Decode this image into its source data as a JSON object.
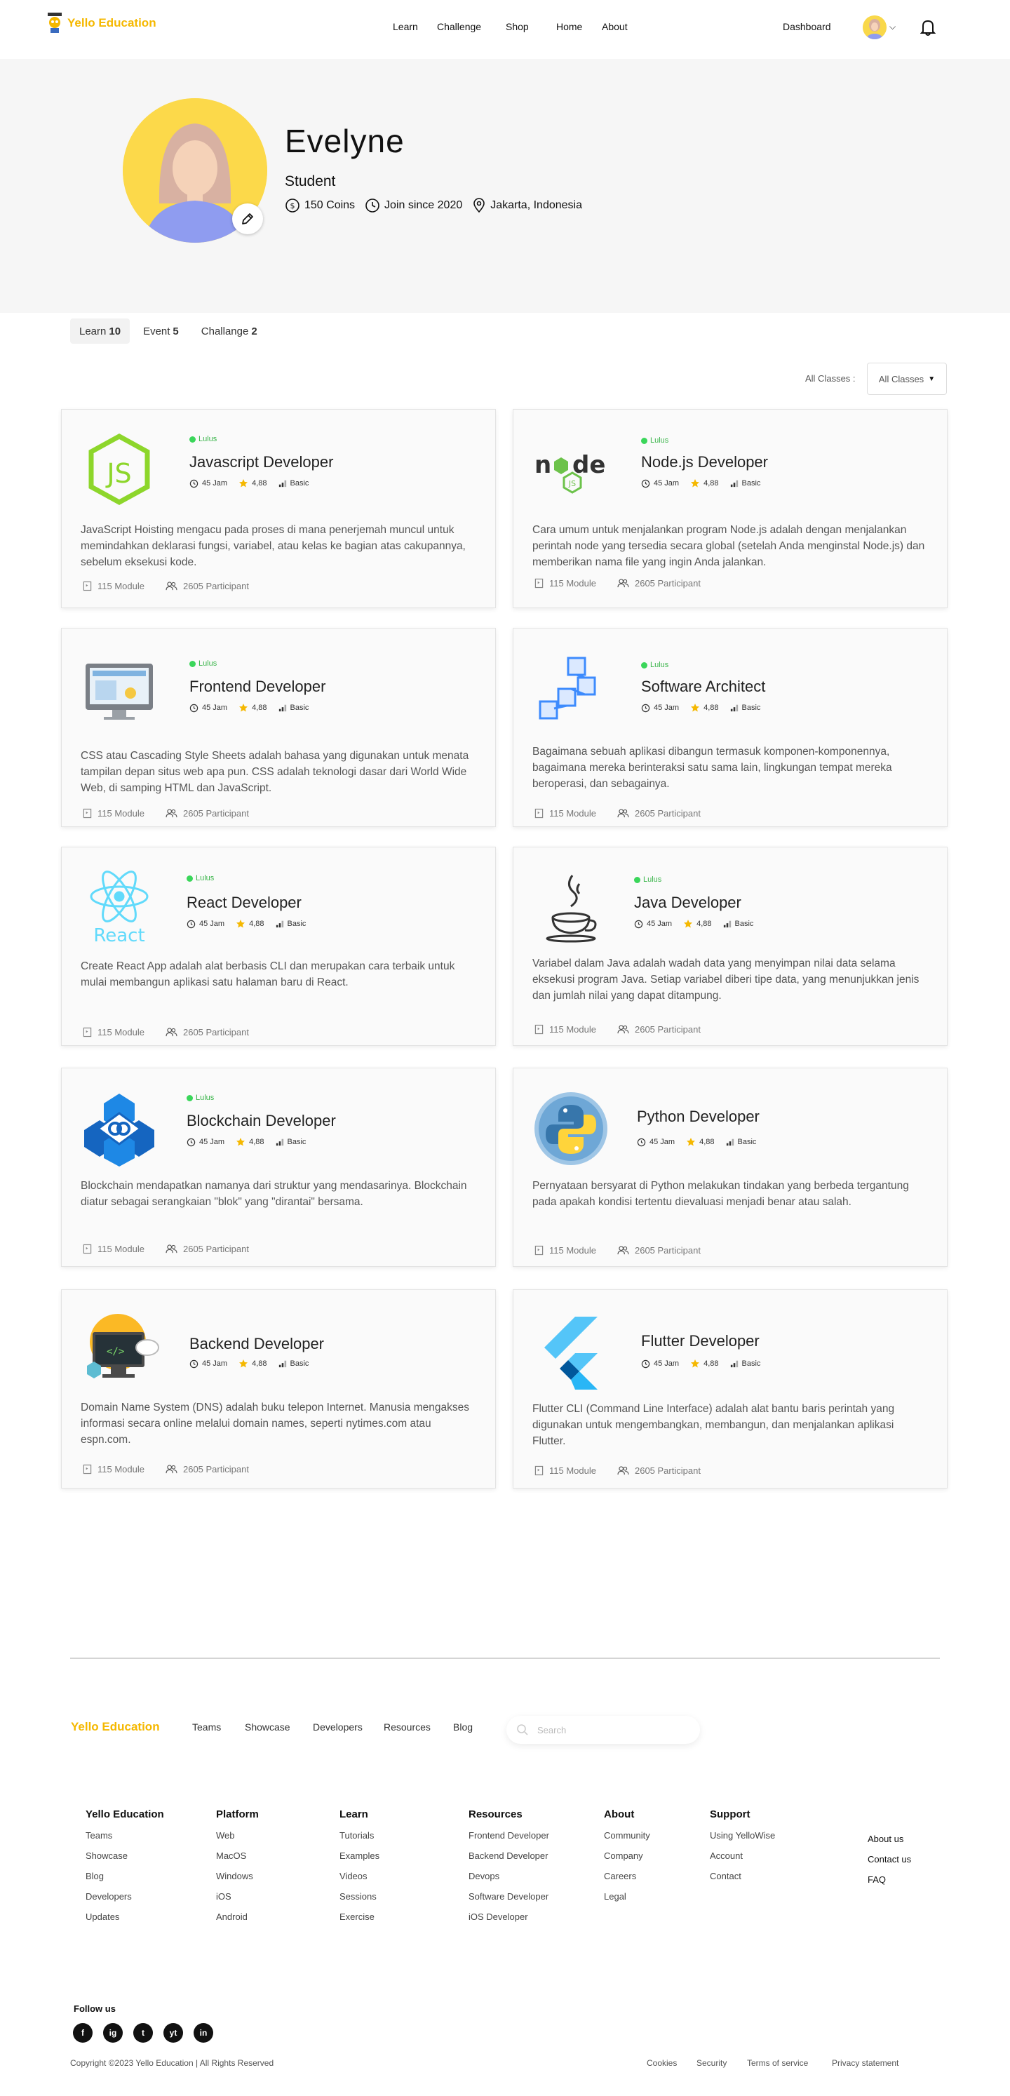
{
  "nav": {
    "brand": "Yello Education",
    "links": [
      "Learn",
      "Challenge",
      "Shop",
      "Home",
      "About"
    ],
    "dashboard": "Dashboard"
  },
  "profile": {
    "name": "Evelyne",
    "role": "Student",
    "coins": "150 Coins",
    "joined": "Join since 2020",
    "location": "Jakarta, Indonesia"
  },
  "tabs": [
    {
      "label": "Learn",
      "count": "10"
    },
    {
      "label": "Event",
      "count": "5"
    },
    {
      "label": "Challange",
      "count": "2"
    }
  ],
  "filter": {
    "label": "All Classes :",
    "value": "All Classes"
  },
  "courses": [
    {
      "badge": "Lulus",
      "title": "Javascript Developer",
      "hours": "45 Jam",
      "rating": "4,88",
      "level": "Basic",
      "desc": "JavaScript Hoisting mengacu pada proses di mana penerjemah muncul untuk memindahkan deklarasi fungsi, variabel, atau kelas ke bagian atas cakupannya, sebelum eksekusi kode.",
      "modules": "115 Module",
      "participants": "2605 Participant",
      "icon": "javascript-icon"
    },
    {
      "badge": "Lulus",
      "title": "Node.js Developer",
      "hours": "45 Jam",
      "rating": "4,88",
      "level": "Basic",
      "desc": "Cara umum untuk menjalankan program Node.js adalah dengan menjalankan perintah node yang tersedia secara global (setelah Anda menginstal Node.js) dan memberikan nama file yang ingin Anda jalankan.",
      "modules": "115 Module",
      "participants": "2605 Participant",
      "icon": "nodejs-icon"
    },
    {
      "badge": "Lulus",
      "title": "Frontend Developer",
      "hours": "45 Jam",
      "rating": "4,88",
      "level": "Basic",
      "desc": "CSS atau Cascading Style Sheets adalah bahasa yang digunakan untuk menata tampilan depan situs web apa pun. CSS adalah teknologi dasar dari World Wide Web, di samping HTML dan JavaScript.",
      "modules": "115 Module",
      "participants": "2605 Participant",
      "icon": "frontend-icon"
    },
    {
      "badge": "Lulus",
      "title": "Software Architect",
      "hours": "45 Jam",
      "rating": "4,88",
      "level": "Basic",
      "desc": "Bagaimana sebuah aplikasi dibangun termasuk komponen-komponennya, bagaimana mereka berinteraksi satu sama lain, lingkungan tempat mereka beroperasi, dan sebagainya.",
      "modules": "115 Module",
      "participants": "2605 Participant",
      "icon": "architecture-icon"
    },
    {
      "badge": "Lulus",
      "title": "React Developer",
      "hours": "45 Jam",
      "rating": "4,88",
      "level": "Basic",
      "desc": "Create React App adalah alat berbasis CLI dan merupakan cara terbaik untuk mulai membangun aplikasi satu halaman baru di React.",
      "modules": "115 Module",
      "participants": "2605 Participant",
      "icon": "react-icon"
    },
    {
      "badge": "Lulus",
      "title": "Java Developer",
      "hours": "45 Jam",
      "rating": "4,88",
      "level": "Basic",
      "desc": "Variabel dalam Java adalah wadah data yang menyimpan nilai data selama eksekusi program Java. Setiap variabel diberi tipe data, yang menunjukkan jenis dan jumlah nilai yang dapat ditampung.",
      "modules": "115 Module",
      "participants": "2605 Participant",
      "icon": "java-icon"
    },
    {
      "badge": "Lulus",
      "title": "Blockchain Developer",
      "hours": "45 Jam",
      "rating": "4,88",
      "level": "Basic",
      "desc": "Blockchain mendapatkan namanya dari struktur yang mendasarinya. Blockchain diatur sebagai serangkaian \"blok\" yang \"dirantai\" bersama.",
      "modules": "115 Module",
      "participants": "2605 Participant",
      "icon": "blockchain-icon"
    },
    {
      "badge": "",
      "title": "Python Developer",
      "hours": "45 Jam",
      "rating": "4,88",
      "level": "Basic",
      "desc": "Pernyataan bersyarat di Python melakukan tindakan yang berbeda tergantung pada apakah kondisi tertentu dievaluasi menjadi benar atau salah.",
      "modules": "115 Module",
      "participants": "2605 Participant",
      "icon": "python-icon"
    },
    {
      "badge": "",
      "title": "Backend Developer",
      "hours": "45 Jam",
      "rating": "4,88",
      "level": "Basic",
      "desc": "Domain Name System (DNS) adalah buku telepon Internet. Manusia mengakses informasi secara online melalui domain names, seperti nytimes.com atau espn.com.",
      "modules": "115 Module",
      "participants": "2605 Participant",
      "icon": "backend-icon"
    },
    {
      "badge": "",
      "title": "Flutter Developer",
      "hours": "45 Jam",
      "rating": "4,88",
      "level": "Basic",
      "desc": "Flutter CLI (Command Line Interface) adalah alat bantu baris perintah yang digunakan untuk mengembangkan, membangun, dan menjalankan aplikasi Flutter.",
      "modules": "115 Module",
      "participants": "2605 Participant",
      "icon": "flutter-icon"
    }
  ],
  "footer": {
    "brand": "Yello Education",
    "top_links": [
      "Teams",
      "Showcase",
      "Developers",
      "Resources",
      "Blog"
    ],
    "search_placeholder": "Search",
    "columns": [
      {
        "title": "Yello Education",
        "items": [
          "Teams",
          "Showcase",
          "Blog",
          "Developers",
          "Updates"
        ]
      },
      {
        "title": "Platform",
        "items": [
          "Web",
          "MacOS",
          "Windows",
          "iOS",
          "Android"
        ]
      },
      {
        "title": "Learn",
        "items": [
          "Tutorials",
          "Examples",
          "Videos",
          "Sessions",
          "Exercise"
        ]
      },
      {
        "title": "Resources",
        "items": [
          "Frontend Developer",
          "Backend Developer",
          "Devops",
          "Software Developer",
          "iOS Developer"
        ]
      },
      {
        "title": "About",
        "items": [
          "Community",
          "Company",
          "Careers",
          "Legal"
        ]
      },
      {
        "title": "Support",
        "items": [
          "Using YelloWise",
          "Account",
          "Contact"
        ]
      }
    ],
    "right_links": [
      "About us",
      "Contact us",
      "FAQ"
    ],
    "follow": "Follow us",
    "socials": [
      "f",
      "ig",
      "t",
      "yt",
      "in"
    ],
    "copyright": "Copyright  ©2023 Yello Education | All Rights Reserved",
    "legal": [
      "Cookies",
      "Security",
      "Terms of service",
      "Privacy statement"
    ]
  }
}
